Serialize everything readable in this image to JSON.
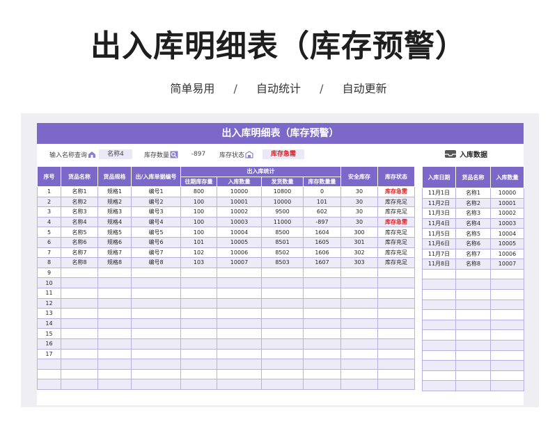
{
  "page": {
    "title": "出入库明细表（库存预警）",
    "subtitle_items": [
      "简单易用",
      "自动统计",
      "自动更新"
    ],
    "subtitle_sep": "/"
  },
  "sheet": {
    "banner": "出入库明细表（库存预警）",
    "search": {
      "name_label": "输入名称查询",
      "name_value": "名称4",
      "stock_label": "库存数量",
      "stock_value": "-897",
      "status_label": "库存状态",
      "status_value": "库存急需"
    },
    "import_label": "入库数据",
    "main_table": {
      "headers": {
        "seq": "序号",
        "name": "货品名称",
        "spec": "货品规格",
        "doc": "出/入库单据编号",
        "group": "出入库统计",
        "prev": "往期库存量",
        "in": "入库数量",
        "out": "发货数量",
        "stock": "库存数量量",
        "safe": "安全库存",
        "status": "库存状态"
      },
      "rows": [
        [
          "1",
          "名称1",
          "规格1",
          "编号1",
          "800",
          "10000",
          "10800",
          "0",
          "30",
          "库存急需"
        ],
        [
          "2",
          "名称2",
          "规格2",
          "编号2",
          "100",
          "10001",
          "10000",
          "101",
          "30",
          "库存充足"
        ],
        [
          "3",
          "名称3",
          "规格3",
          "编号3",
          "100",
          "10002",
          "9500",
          "602",
          "30",
          "库存充足"
        ],
        [
          "4",
          "名称4",
          "规格4",
          "编号4",
          "100",
          "10003",
          "11000",
          "-897",
          "30",
          "库存急需"
        ],
        [
          "5",
          "名称5",
          "规格5",
          "编号5",
          "100",
          "10004",
          "8500",
          "1604",
          "300",
          "库存充足"
        ],
        [
          "6",
          "名称6",
          "规格6",
          "编号6",
          "101",
          "10005",
          "8501",
          "1605",
          "301",
          "库存充足"
        ],
        [
          "7",
          "名称7",
          "规格7",
          "编号7",
          "102",
          "10006",
          "8502",
          "1606",
          "302",
          "库存充足"
        ],
        [
          "8",
          "名称8",
          "规格8",
          "编号8",
          "103",
          "10007",
          "8503",
          "1607",
          "303",
          "库存充足"
        ],
        [
          "9",
          "",
          "",
          "",
          "",
          "",
          "",
          "",
          "",
          ""
        ],
        [
          "10",
          "",
          "",
          "",
          "",
          "",
          "",
          "",
          "",
          ""
        ],
        [
          "11",
          "",
          "",
          "",
          "",
          "",
          "",
          "",
          "",
          ""
        ],
        [
          "12",
          "",
          "",
          "",
          "",
          "",
          "",
          "",
          "",
          ""
        ],
        [
          "13",
          "",
          "",
          "",
          "",
          "",
          "",
          "",
          "",
          ""
        ],
        [
          "14",
          "",
          "",
          "",
          "",
          "",
          "",
          "",
          "",
          ""
        ],
        [
          "15",
          "",
          "",
          "",
          "",
          "",
          "",
          "",
          "",
          ""
        ],
        [
          "16",
          "",
          "",
          "",
          "",
          "",
          "",
          "",
          "",
          ""
        ],
        [
          "17",
          "",
          "",
          "",
          "",
          "",
          "",
          "",
          "",
          ""
        ],
        [
          "",
          "",
          "",
          "",
          "",
          "",
          "",
          "",
          "",
          ""
        ],
        [
          "",
          "",
          "",
          "",
          "",
          "",
          "",
          "",
          "",
          ""
        ],
        [
          "",
          "",
          "",
          "",
          "",
          "",
          "",
          "",
          "",
          ""
        ]
      ]
    },
    "side_table": {
      "headers": {
        "date": "入库日期",
        "name": "货品名称",
        "qty": "入库数量"
      },
      "rows": [
        [
          "11月1日",
          "名称1",
          "10000"
        ],
        [
          "11月2日",
          "名称2",
          "10001"
        ],
        [
          "11月3日",
          "名称3",
          "10002"
        ],
        [
          "11月4日",
          "名称4",
          "10003"
        ],
        [
          "11月5日",
          "名称5",
          "10004"
        ],
        [
          "11月6日",
          "名称6",
          "10005"
        ],
        [
          "11月7日",
          "名称7",
          "10006"
        ],
        [
          "11月8日",
          "名称8",
          "10007"
        ],
        [
          "",
          "",
          ""
        ],
        [
          "",
          "",
          ""
        ],
        [
          "",
          "",
          ""
        ],
        [
          "",
          "",
          ""
        ],
        [
          "",
          "",
          ""
        ],
        [
          "",
          "",
          ""
        ],
        [
          "",
          "",
          ""
        ],
        [
          "",
          "",
          ""
        ],
        [
          "",
          "",
          ""
        ],
        [
          "",
          "",
          ""
        ],
        [
          "",
          "",
          ""
        ],
        [
          "",
          "",
          ""
        ]
      ]
    },
    "colors": {
      "accent": "#7b68c9",
      "alt_row": "#eeebf9",
      "danger": "#e02020"
    },
    "danger_status": "库存急需"
  }
}
